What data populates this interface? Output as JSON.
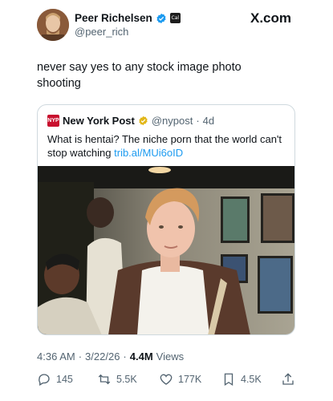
{
  "author": {
    "name": "Peer Richelsen",
    "handle": "@peer_rich",
    "affiliate_badge": "Cal"
  },
  "source_label": "X.com",
  "tweet": {
    "text": "never say yes to any stock image photo shooting"
  },
  "quoted": {
    "name": "New York Post",
    "logo_text": "NYP",
    "handle": "@nypost",
    "separator": "·",
    "time": "4d",
    "text": "What is hentai? The niche porn that the world can't stop watching",
    "link": "trib.al/MUi6oID"
  },
  "meta": {
    "time": "4:36 AM",
    "dot": "·",
    "date": "3/22/26",
    "views_count": "4.4M",
    "views_label": "Views"
  },
  "actions": {
    "replies": "145",
    "reposts": "5.5K",
    "likes": "177K",
    "bookmarks": "4.5K"
  },
  "colors": {
    "link": "#1d9bf0",
    "verified_blue": "#1d9bf0",
    "verified_gold": "#e2b719",
    "muted": "#536471",
    "nyp_red": "#c8102e"
  }
}
